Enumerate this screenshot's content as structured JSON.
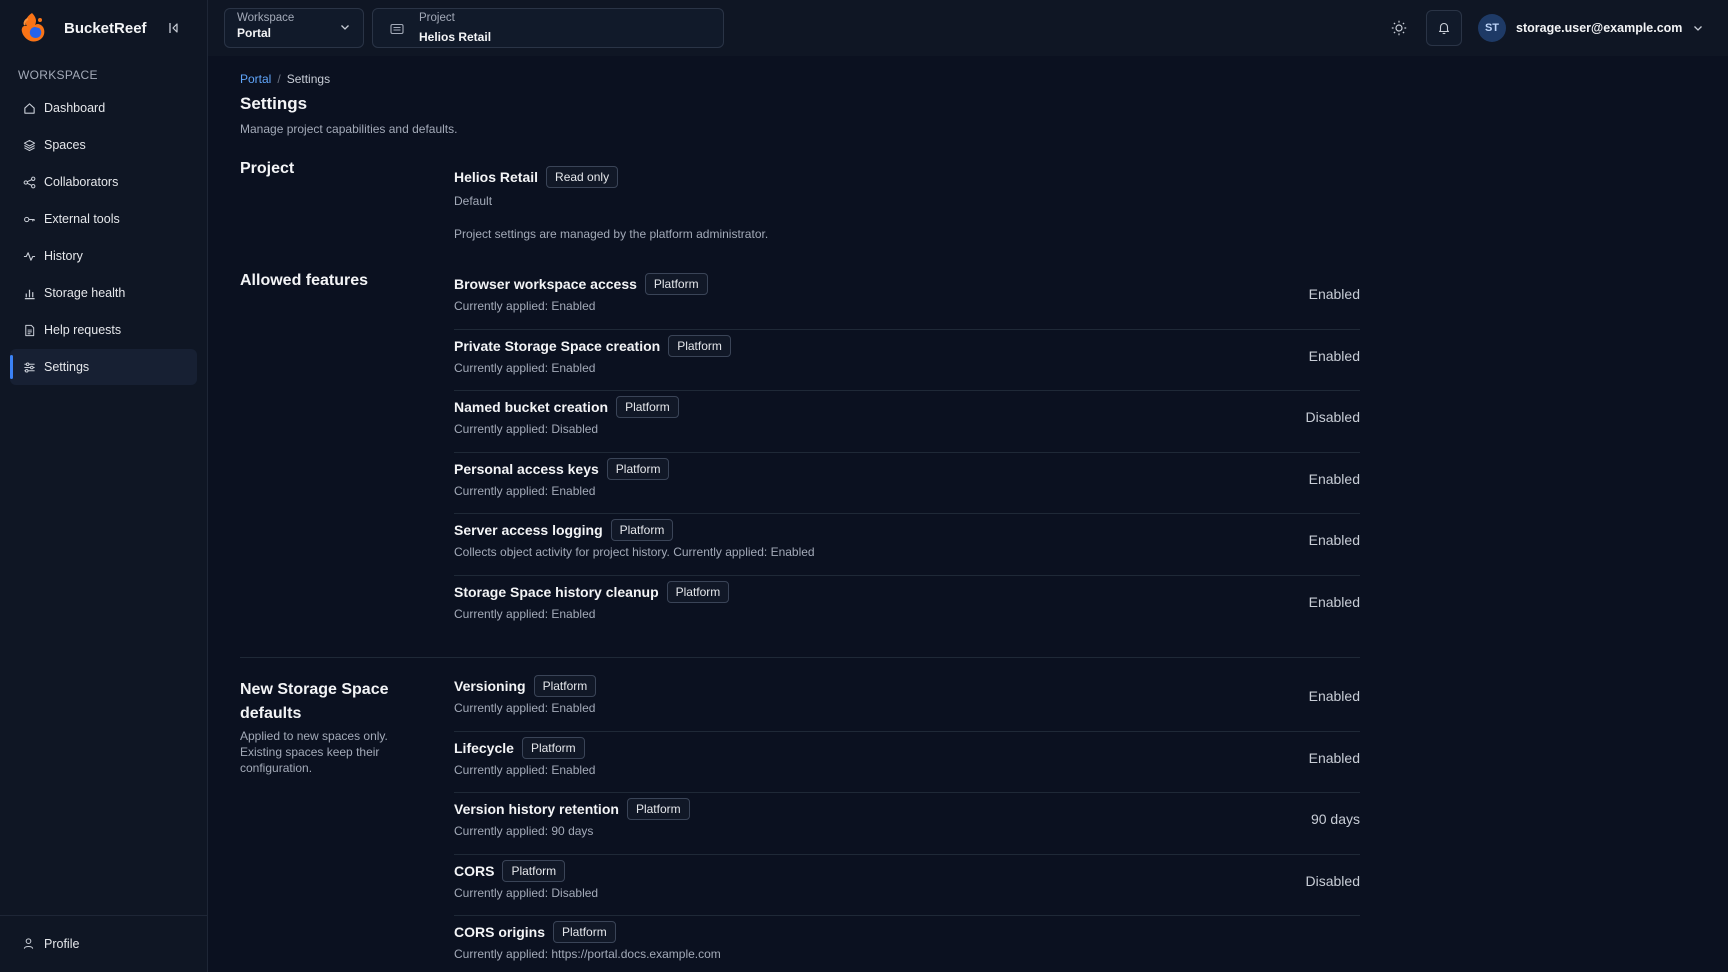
{
  "app": {
    "name": "BucketReef"
  },
  "sidebar": {
    "section_label": "WORKSPACE",
    "items": [
      {
        "label": "Dashboard",
        "icon": "home-icon"
      },
      {
        "label": "Spaces",
        "icon": "layers-icon"
      },
      {
        "label": "Collaborators",
        "icon": "share-icon"
      },
      {
        "label": "External tools",
        "icon": "key-icon"
      },
      {
        "label": "History",
        "icon": "activity-icon"
      },
      {
        "label": "Storage health",
        "icon": "bar-chart-icon"
      },
      {
        "label": "Help requests",
        "icon": "file-text-icon"
      },
      {
        "label": "Settings",
        "icon": "sliders-icon",
        "active": true
      }
    ],
    "footer_label": "Profile"
  },
  "header": {
    "workspace_label": "Workspace",
    "workspace_value": "Portal",
    "project_label": "Project",
    "project_value": "Helios Retail",
    "user_initials": "ST",
    "user_email": "storage.user@example.com"
  },
  "breadcrumb": {
    "root": "Portal",
    "separator": "/",
    "current": "Settings"
  },
  "page": {
    "title": "Settings",
    "subtitle": "Manage project capabilities and defaults."
  },
  "project_section": {
    "title": "Project",
    "name": "Helios Retail",
    "badge": "Read only",
    "default_label": "Default",
    "note": "Project settings are managed by the platform administrator."
  },
  "allowed_features": {
    "title": "Allowed features",
    "rows": [
      {
        "title": "Browser workspace access",
        "badge": "Platform",
        "sub": "Currently applied: Enabled",
        "value": "Enabled"
      },
      {
        "title": "Private Storage Space creation",
        "badge": "Platform",
        "sub": "Currently applied: Enabled",
        "value": "Enabled"
      },
      {
        "title": "Named bucket creation",
        "badge": "Platform",
        "sub": "Currently applied: Disabled",
        "value": "Disabled"
      },
      {
        "title": "Personal access keys",
        "badge": "Platform",
        "sub": "Currently applied: Enabled",
        "value": "Enabled"
      },
      {
        "title": "Server access logging",
        "badge": "Platform",
        "sub": "Collects object activity for project history. Currently applied: Enabled",
        "value": "Enabled"
      },
      {
        "title": "Storage Space history cleanup",
        "badge": "Platform",
        "sub": "Currently applied: Enabled",
        "value": "Enabled"
      }
    ]
  },
  "new_defaults": {
    "title": "New Storage Space defaults",
    "description": "Applied to new spaces only. Existing spaces keep their configuration.",
    "rows": [
      {
        "title": "Versioning",
        "badge": "Platform",
        "sub": "Currently applied: Enabled",
        "value": "Enabled"
      },
      {
        "title": "Lifecycle",
        "badge": "Platform",
        "sub": "Currently applied: Enabled",
        "value": "Enabled"
      },
      {
        "title": "Version history retention",
        "badge": "Platform",
        "sub": "Currently applied: 90 days",
        "value": "90 days"
      },
      {
        "title": "CORS",
        "badge": "Platform",
        "sub": "Currently applied: Disabled",
        "value": "Disabled"
      },
      {
        "title": "CORS origins",
        "badge": "Platform",
        "sub": "Currently applied: https://portal.docs.example.com",
        "value": ""
      }
    ]
  },
  "colors": {
    "background": "#0b1120",
    "sidebar": "#0f1624",
    "accent": "#3b82f6",
    "link": "#60a5fa"
  }
}
